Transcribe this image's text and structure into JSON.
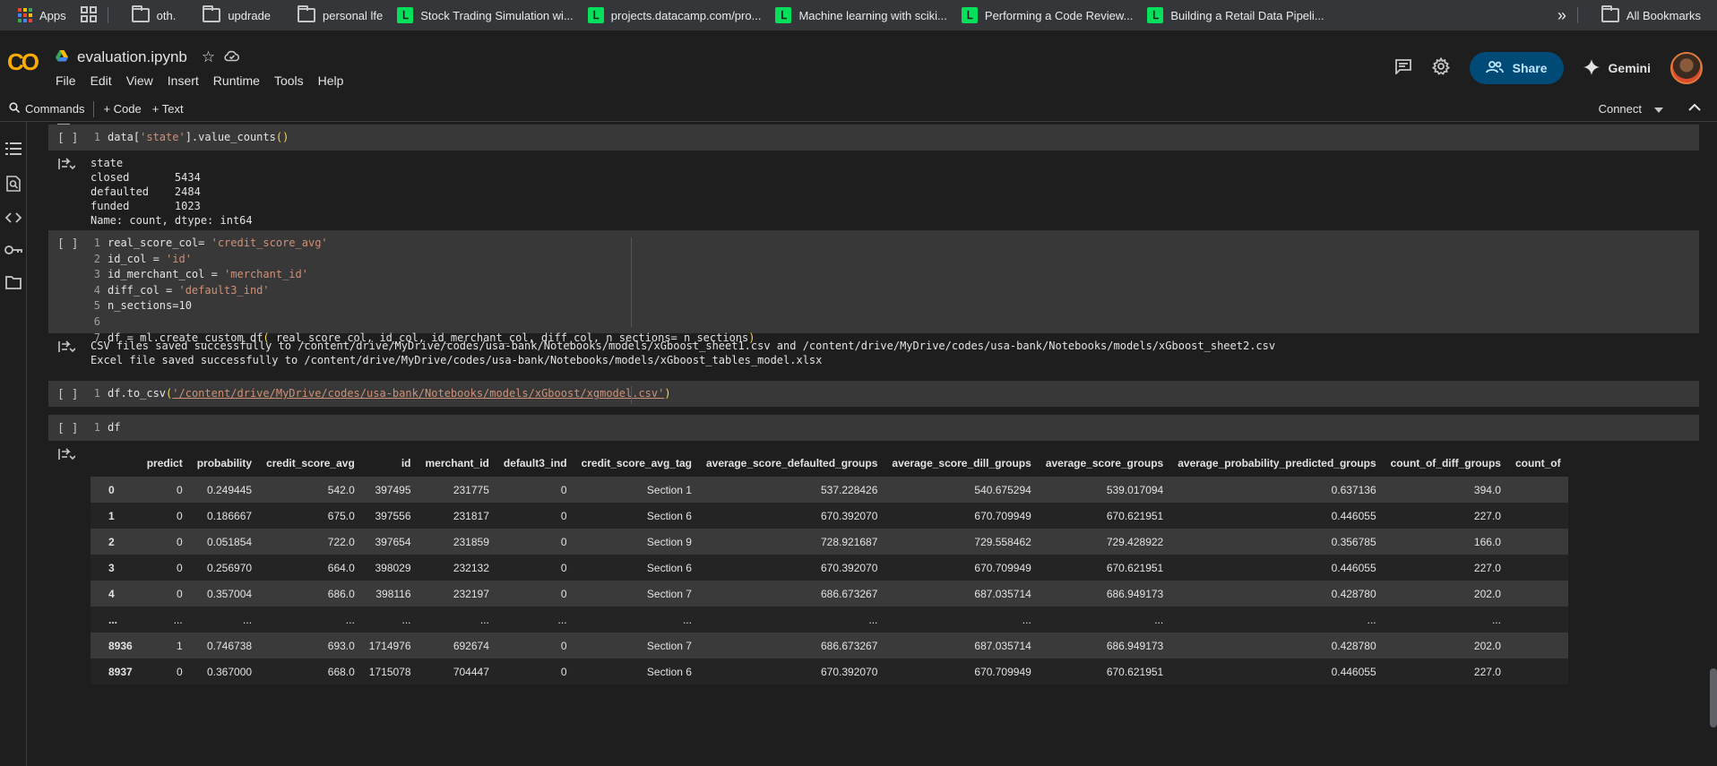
{
  "bookmarks": {
    "apps": "Apps",
    "items": [
      {
        "label": "oth.",
        "icon": "folder-icon"
      },
      {
        "label": "updrade",
        "icon": "folder-icon"
      },
      {
        "label": "personal lfe",
        "icon": "folder-icon"
      },
      {
        "label": "Stock Trading Simulation wi...",
        "icon": "datacamp-icon"
      },
      {
        "label": "projects.datacamp.com/pro...",
        "icon": "datacamp-icon"
      },
      {
        "label": "Machine learning with sciki...",
        "icon": "datacamp-icon"
      },
      {
        "label": "Performing a Code Review...",
        "icon": "datacamp-icon"
      },
      {
        "label": "Building a Retail Data Pipeli...",
        "icon": "datacamp-icon"
      }
    ],
    "more": "»",
    "all_bookmarks": "All Bookmarks"
  },
  "header": {
    "logo": "CO",
    "filename": "evaluation.ipynb",
    "menu": [
      "File",
      "Edit",
      "View",
      "Insert",
      "Runtime",
      "Tools",
      "Help"
    ],
    "share": "Share",
    "gemini": "Gemini"
  },
  "toolbar": {
    "commands": "Commands",
    "code": "+ Code",
    "text": "+ Text",
    "connect": "Connect"
  },
  "cells": [
    {
      "run_label": "[ ]",
      "lines": [
        "1"
      ],
      "output": [
        "state",
        "closed       5434",
        "defaulted    2484",
        "funded       1023",
        "Name: count, dtype: int64"
      ]
    },
    {
      "run_label": "[ ]",
      "lines": [
        "1",
        "2",
        "3",
        "4",
        "5",
        "6",
        "7"
      ],
      "output": [
        "CSV files saved successfully to /content/drive/MyDrive/codes/usa-bank/Notebooks/models/xGboost_sheet1.csv and /content/drive/MyDrive/codes/usa-bank/Notebooks/models/xGboost_sheet2.csv",
        "Excel file saved successfully to /content/drive/MyDrive/codes/usa-bank/Notebooks/models/xGboost_tables_model.xlsx"
      ]
    },
    {
      "run_label": "[ ]",
      "lines": [
        "1"
      ]
    },
    {
      "run_label": "[ ]",
      "lines": [
        "1"
      ]
    }
  ],
  "code": {
    "c1": {
      "a": "data[",
      "s": "'state'",
      "b": "].value_counts",
      "p": "()"
    },
    "c2": {
      "l1a": "real_score_col= ",
      "l1s": "'credit_score_avg'",
      "l2a": "id_col = ",
      "l2s": "'id'",
      "l3a": "id_merchant_col = ",
      "l3s": "'merchant_id'",
      "l4a": "diff_col = ",
      "l4s": "'default3_ind'",
      "l5": "n_sections=10",
      "l6": "",
      "l7a": "df = ml.create_custom_df",
      "l7p1": "(",
      "l7b": " real_score_col, id_col, id_merchant_col, diff_col, n_sections= n_sections",
      "l7p2": ")"
    },
    "c3": {
      "a": "df.to_csv",
      "p1": "(",
      "s": "'/content/drive/MyDrive/codes/usa-bank/Notebooks/models/xGboost/xgmodel.csv'",
      "p2": ")"
    },
    "c4": {
      "a": "df"
    }
  },
  "table": {
    "columns": [
      "",
      "predict",
      "probability",
      "credit_score_avg",
      "id",
      "merchant_id",
      "default3_ind",
      "credit_score_avg_tag",
      "average_score_defaulted_groups",
      "average_score_dill_groups",
      "average_score_groups",
      "average_probability_predicted_groups",
      "count_of_diff_groups",
      "count_of"
    ],
    "rows": [
      [
        "0",
        "0",
        "0.249445",
        "542.0",
        "397495",
        "231775",
        "0",
        "Section 1",
        "537.228426",
        "540.675294",
        "539.017094",
        "0.637136",
        "394.0",
        ""
      ],
      [
        "1",
        "0",
        "0.186667",
        "675.0",
        "397556",
        "231817",
        "0",
        "Section 6",
        "670.392070",
        "670.709949",
        "670.621951",
        "0.446055",
        "227.0",
        ""
      ],
      [
        "2",
        "0",
        "0.051854",
        "722.0",
        "397654",
        "231859",
        "0",
        "Section 9",
        "728.921687",
        "729.558462",
        "729.428922",
        "0.356785",
        "166.0",
        ""
      ],
      [
        "3",
        "0",
        "0.256970",
        "664.0",
        "398029",
        "232132",
        "0",
        "Section 6",
        "670.392070",
        "670.709949",
        "670.621951",
        "0.446055",
        "227.0",
        ""
      ],
      [
        "4",
        "0",
        "0.357004",
        "686.0",
        "398116",
        "232197",
        "0",
        "Section 7",
        "686.673267",
        "687.035714",
        "686.949173",
        "0.428780",
        "202.0",
        ""
      ],
      [
        "...",
        "...",
        "...",
        "...",
        "...",
        "...",
        "...",
        "...",
        "...",
        "...",
        "...",
        "...",
        "...",
        ""
      ],
      [
        "8936",
        "1",
        "0.746738",
        "693.0",
        "1714976",
        "692674",
        "0",
        "Section 7",
        "686.673267",
        "687.035714",
        "686.949173",
        "0.428780",
        "202.0",
        ""
      ],
      [
        "8937",
        "0",
        "0.367000",
        "668.0",
        "1715078",
        "704447",
        "0",
        "Section 6",
        "670.392070",
        "670.709949",
        "670.621951",
        "0.446055",
        "227.0",
        ""
      ]
    ]
  }
}
